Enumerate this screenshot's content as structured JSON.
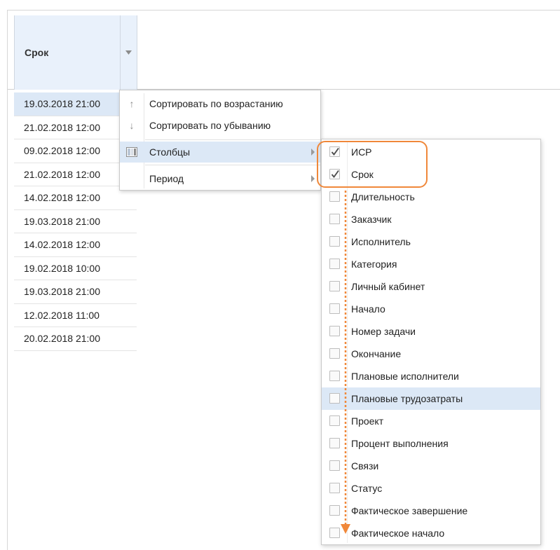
{
  "grid": {
    "column_header": "Срок",
    "rows": [
      "19.03.2018 21:00",
      "21.02.2018 12:00",
      "09.02.2018 12:00",
      "21.02.2018 12:00",
      "14.02.2018 12:00",
      "19.03.2018 21:00",
      "14.02.2018 12:00",
      "19.02.2018 10:00",
      "19.03.2018 21:00",
      "12.02.2018 11:00",
      "20.02.2018 21:00"
    ]
  },
  "menu": {
    "sort_asc": "Сортировать по возрастанию",
    "sort_desc": "Сортировать по убыванию",
    "columns": "Столбцы",
    "period": "Период"
  },
  "columns_submenu": [
    {
      "label": "ИСР",
      "checked": true
    },
    {
      "label": "Срок",
      "checked": true
    },
    {
      "label": "Длительность",
      "checked": false
    },
    {
      "label": "Заказчик",
      "checked": false
    },
    {
      "label": "Исполнитель",
      "checked": false
    },
    {
      "label": "Категория",
      "checked": false
    },
    {
      "label": "Личный кабинет",
      "checked": false
    },
    {
      "label": "Начало",
      "checked": false
    },
    {
      "label": "Номер задачи",
      "checked": false
    },
    {
      "label": "Окончание",
      "checked": false
    },
    {
      "label": "Плановые исполнители",
      "checked": false
    },
    {
      "label": "Плановые трудозатраты",
      "checked": false
    },
    {
      "label": "Проект",
      "checked": false
    },
    {
      "label": "Процент выполнения",
      "checked": false
    },
    {
      "label": "Связи",
      "checked": false
    },
    {
      "label": "Статус",
      "checked": false
    },
    {
      "label": "Фактическое завершение",
      "checked": false
    },
    {
      "label": "Фактическое начало",
      "checked": false
    }
  ],
  "icons": {
    "sort_asc": "arrow-up-icon",
    "sort_desc": "arrow-down-icon",
    "columns": "columns-icon",
    "submenu": "chevron-right-icon",
    "header_trigger": "chevron-down-icon"
  },
  "colors": {
    "accent_orange": "#f0883a",
    "selection_blue": "#dce8f6",
    "header_blue": "#e9f1fb"
  }
}
